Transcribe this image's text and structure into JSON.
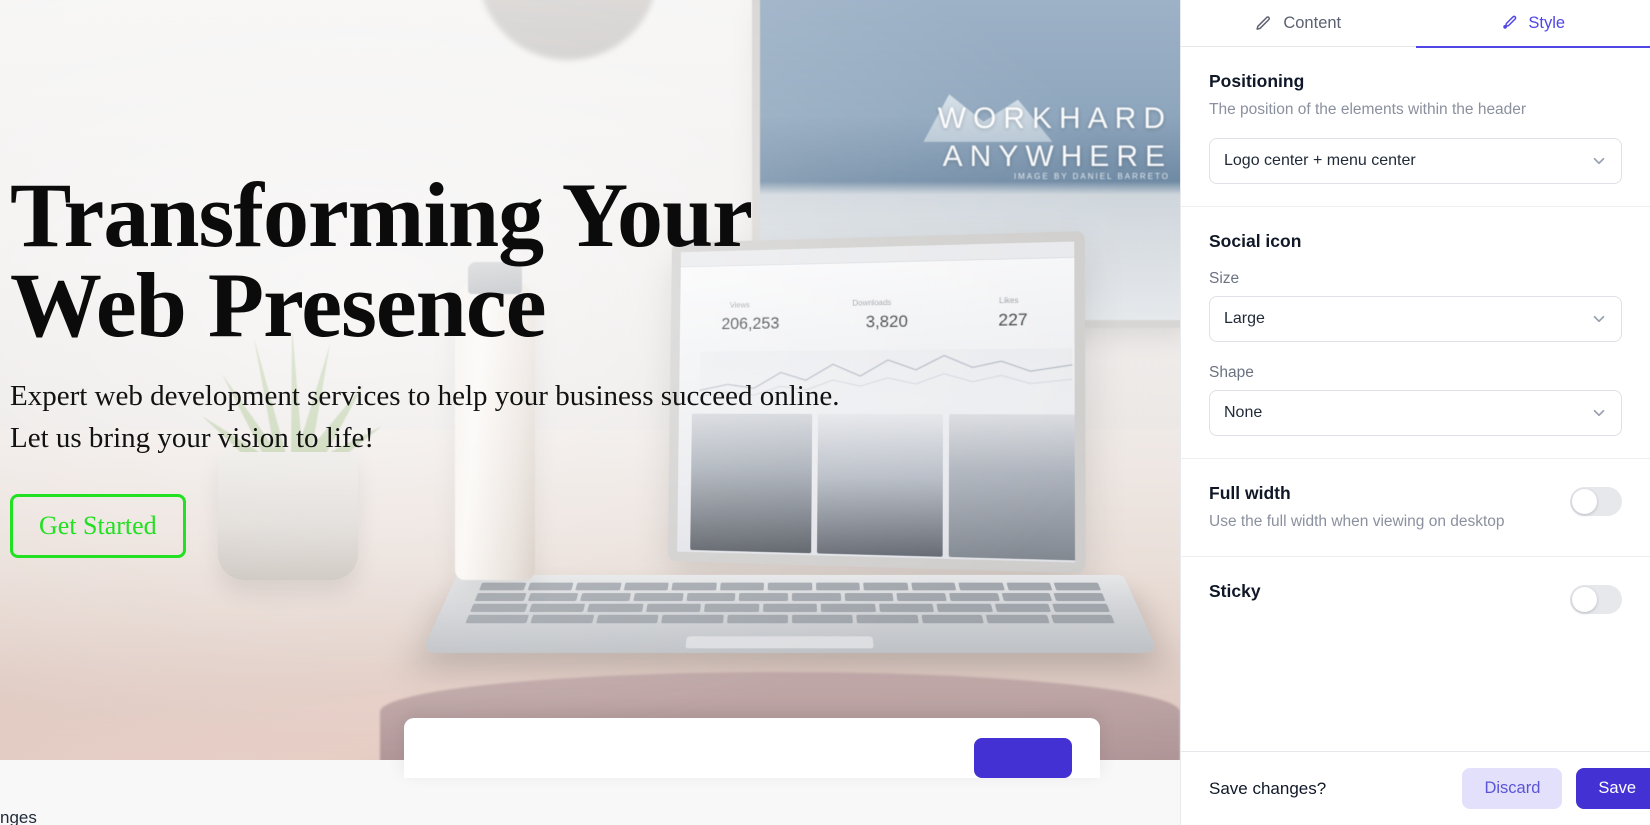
{
  "preview": {
    "hero": {
      "title_line1": "Transforming Your",
      "title_line2": "Web Presence",
      "subtitle_line1": "Expert web development services to help your business succeed online.",
      "subtitle_line2": "Let us bring your vision to life!",
      "cta_label": "Get Started",
      "cta_color": "#22e022"
    },
    "monitor_wallpaper": {
      "line1": "WORKHARD",
      "line2": "ANYWHERE",
      "credit": "IMAGE BY DANIEL BARRETO"
    },
    "laptop_dashboard": {
      "stat_labels": [
        "Views",
        "Downloads",
        "Likes"
      ],
      "stat_values": [
        "206,253",
        "3,820",
        "227"
      ]
    },
    "bottom_text": "nges"
  },
  "panel": {
    "tabs": [
      {
        "label": "Content",
        "icon": "pencil-icon",
        "active": false
      },
      {
        "label": "Style",
        "icon": "paintbrush-icon",
        "active": true
      }
    ],
    "sections": {
      "positioning": {
        "title": "Positioning",
        "description": "The position of the elements within the header",
        "select_value": "Logo center + menu center"
      },
      "social_icon": {
        "title": "Social icon",
        "size_label": "Size",
        "size_value": "Large",
        "shape_label": "Shape",
        "shape_value": "None"
      },
      "full_width": {
        "title": "Full width",
        "description": "Use the full width when viewing on desktop",
        "toggle_state": "off"
      },
      "sticky": {
        "title": "Sticky",
        "toggle_state": "off"
      }
    },
    "savebar": {
      "prompt": "Save changes?",
      "discard_label": "Discard",
      "save_label": "Save"
    },
    "colors": {
      "accent": "#4f46e5",
      "save_button": "#4331d4",
      "discard_background": "#e3e0fb",
      "discard_text": "#5b54d6"
    }
  }
}
